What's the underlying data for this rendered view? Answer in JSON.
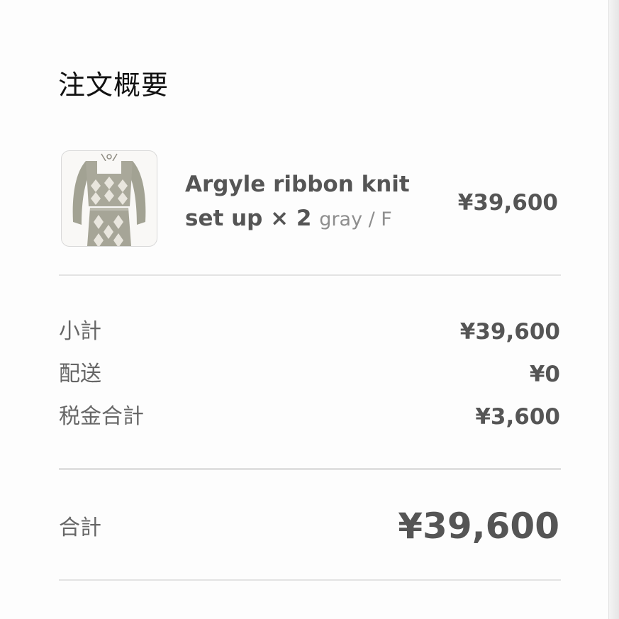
{
  "summary": {
    "title": "注文概要"
  },
  "item": {
    "name": "Argyle ribbon knit set up × 2",
    "variant": "gray / F",
    "price": "¥39,600",
    "thumbnail_icon": "product-image-knit-setup"
  },
  "breakdown": [
    {
      "label": "小計",
      "value": "¥39,600"
    },
    {
      "label": "配送",
      "value": "¥0"
    },
    {
      "label": "税金合計",
      "value": "¥3,600"
    }
  ],
  "total": {
    "label": "合計",
    "value": "¥39,600"
  },
  "colors": {
    "text_dark": "#111111",
    "text_muted": "#555555",
    "label": "#666666",
    "divider": "#e3e3e3"
  }
}
